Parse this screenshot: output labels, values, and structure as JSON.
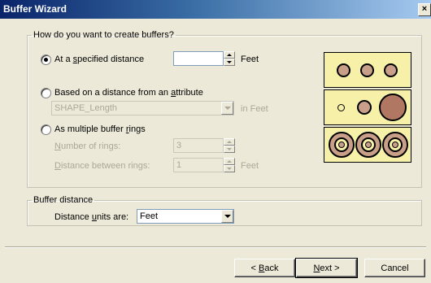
{
  "window": {
    "title": "Buffer Wizard",
    "close_glyph": "×"
  },
  "create_group": {
    "legend": "How do you want to create buffers?",
    "option_distance": {
      "label": "At a specified distance",
      "checked": true,
      "value": "",
      "unit": "Feet"
    },
    "option_attribute": {
      "label": "Based on a distance from an attribute",
      "checked": false,
      "field_value": "SHAPE_Length",
      "unit": "in Feet"
    },
    "option_rings": {
      "label": "As multiple buffer rings",
      "checked": false,
      "rings_label": "Number of rings:",
      "rings_value": "3",
      "distance_label": "Distance between rings:",
      "distance_value": "1",
      "unit": "Feet"
    },
    "illustration_colors": {
      "fill": "#f6f0a8",
      "circle": "#c99f8a"
    }
  },
  "buffer_distance_group": {
    "legend": "Buffer distance",
    "units_label": "Distance units are:",
    "units_value": "Feet"
  },
  "buttons": {
    "back": "< Back",
    "next": "Next >",
    "cancel": "Cancel"
  }
}
